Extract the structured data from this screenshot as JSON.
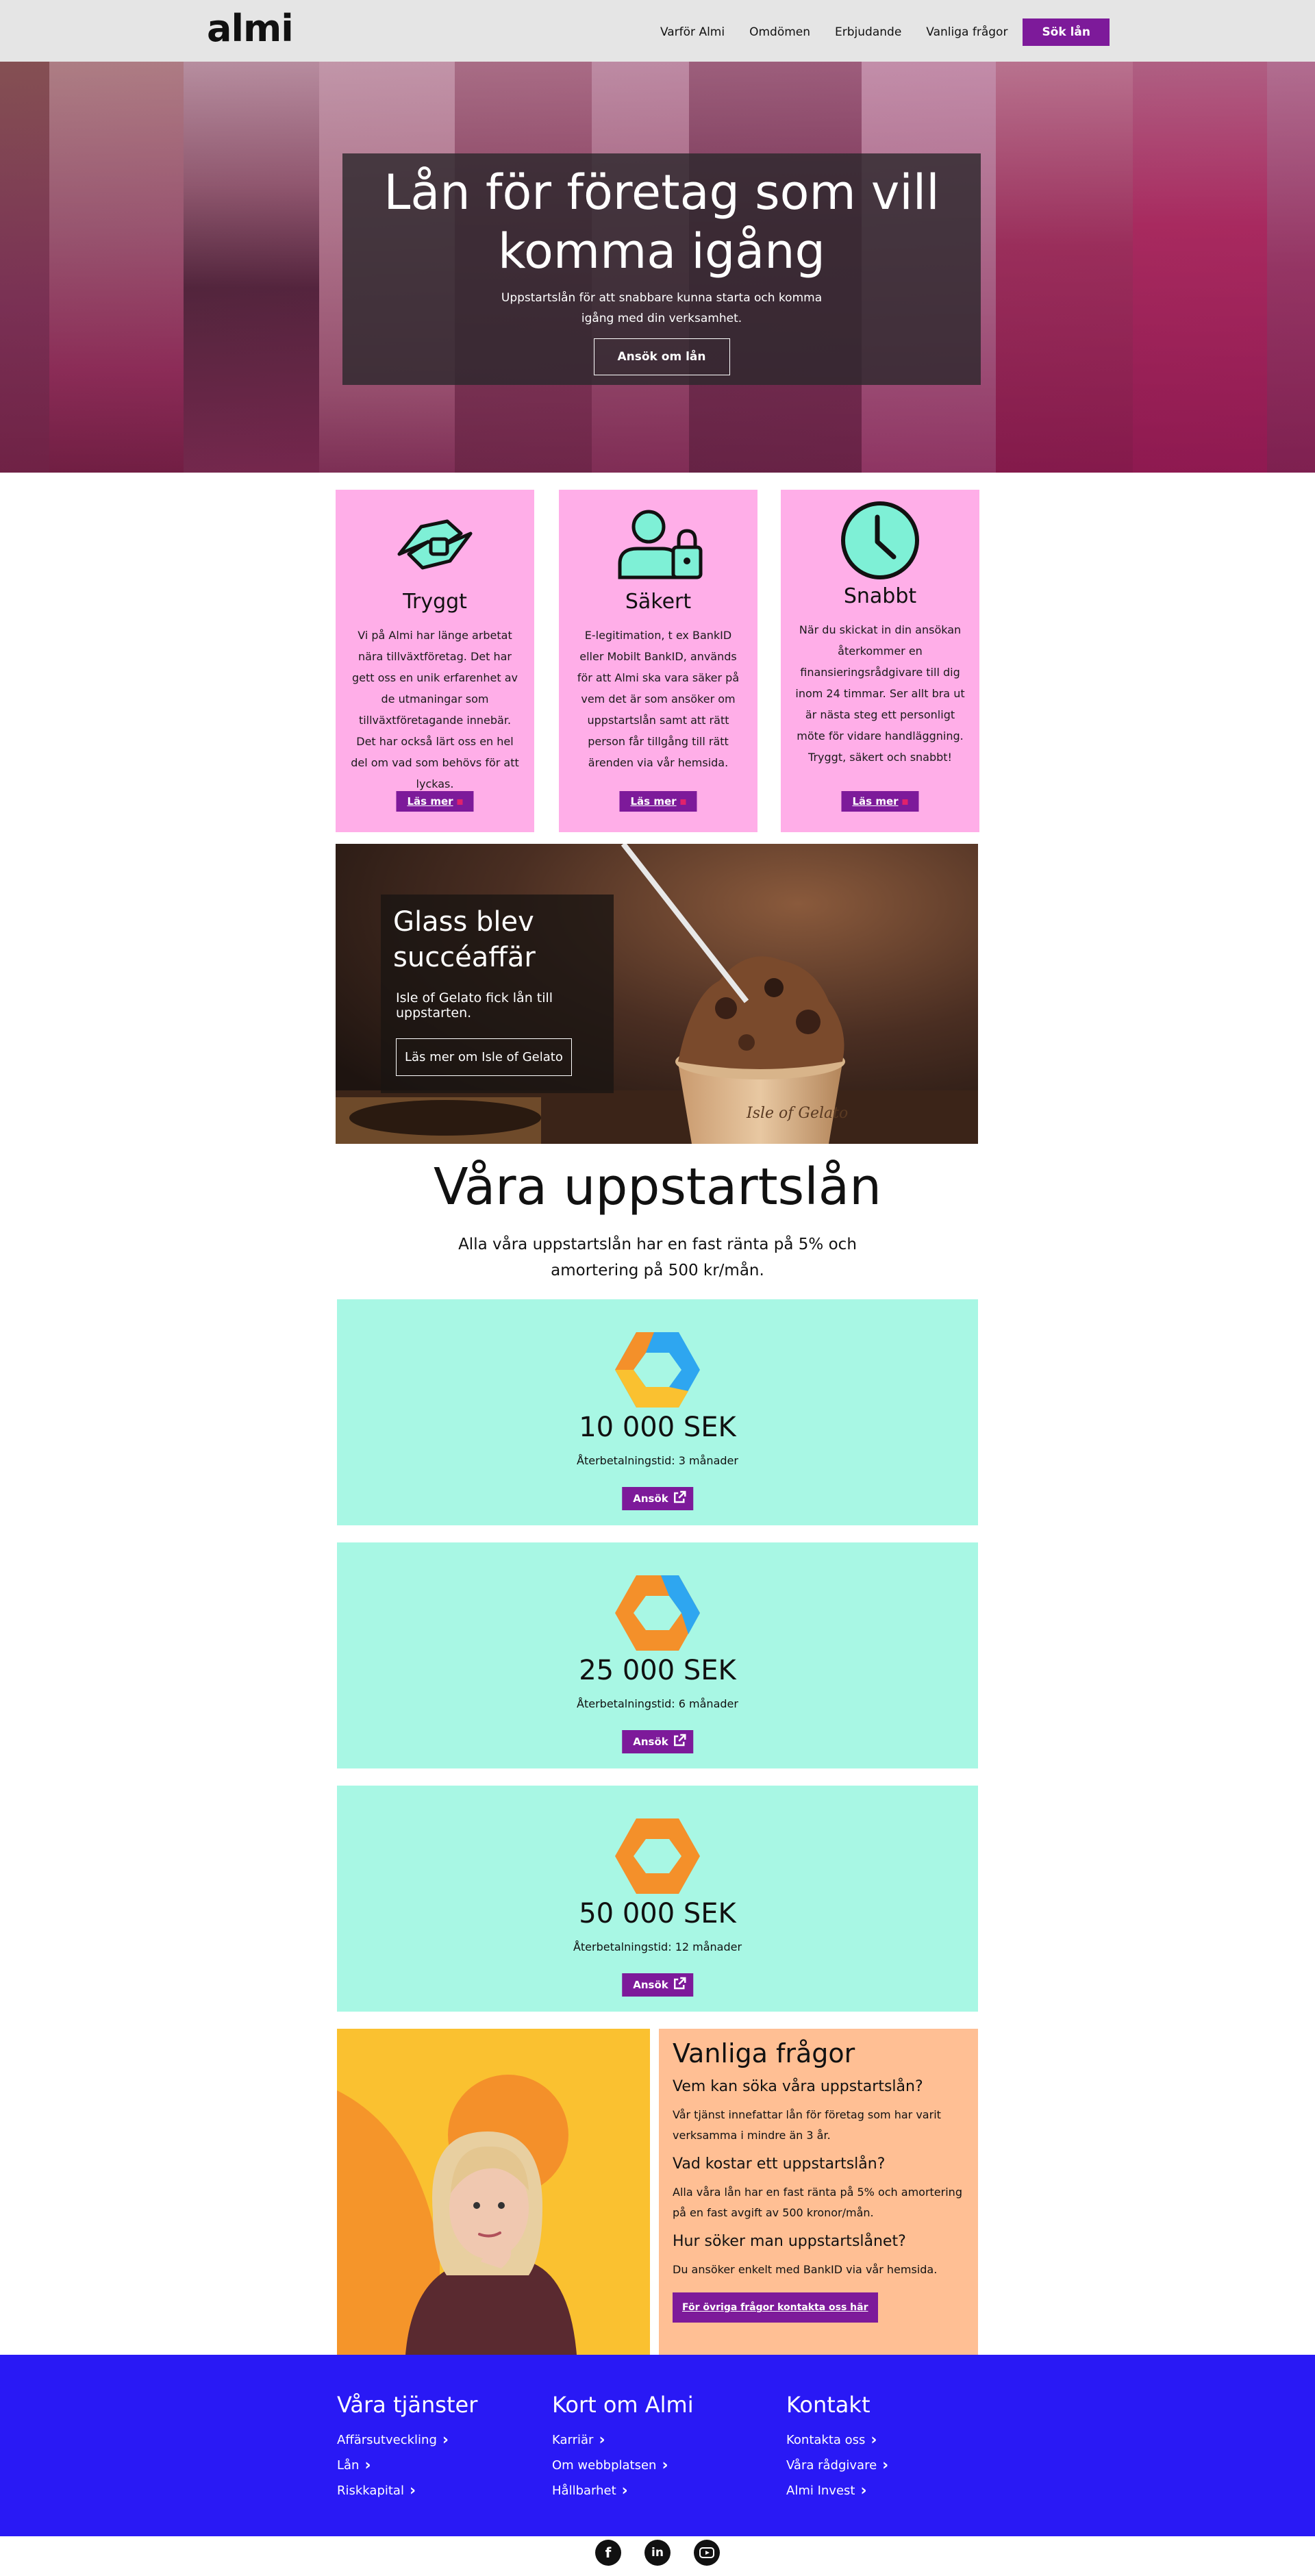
{
  "header": {
    "logo": "almi",
    "nav": [
      "Varför Almi",
      "Omdömen",
      "Erbjudande",
      "Vanliga frågor"
    ],
    "cta": "Sök lån"
  },
  "hero": {
    "title": "Lån för företag som vill komma igång",
    "subtitle": "Uppstartslån för att snabbare kunna starta och komma igång med din verksamhet.",
    "button": "Ansök om lån"
  },
  "features": [
    {
      "icon": "handshake-icon",
      "title": "Tryggt",
      "text": "Vi på Almi har länge arbetat nära tillväxtföretag. Det har gett oss en unik erfarenhet av de utmaningar som tillväxtföretagande innebär. Det har också lärt oss en hel del om vad som behövs för att lyckas.",
      "button": "Läs mer"
    },
    {
      "icon": "user-lock-icon",
      "title": "Säkert",
      "text": "E-legitimation, t ex BankID eller Mobilt BankID, används för att Almi ska vara säker på vem det är som ansöker om uppstartslån samt att rätt person får tillgång till rätt ärenden via vår hemsida.",
      "button": "Läs mer"
    },
    {
      "icon": "clock-icon",
      "title": "Snabbt",
      "text": "När du skickat in din ansökan återkommer en finansieringsrådgivare till dig inom 24 timmar. Ser allt bra ut är nästa steg ett personligt möte för vidare handläggning. Tryggt, säkert och snabbt!",
      "button": "Läs mer"
    }
  ],
  "banner": {
    "title": "Glass blev succéaffär",
    "text": "Isle of Gelato fick lån till uppstarten.",
    "button": "Läs mer om Isle of Gelato",
    "cup_text": "Isle of Gelato"
  },
  "loans_section": {
    "title": "Våra uppstartslån",
    "subtitle": "Alla våra uppstartslån har en fast ränta på 5% och amortering på 500 kr/mån."
  },
  "loans": [
    {
      "amount": "10 000 SEK",
      "term": "Återbetalningstid: 3 månader",
      "button": "Ansök"
    },
    {
      "amount": "25 000 SEK",
      "term": "Återbetalningstid: 6 månader",
      "button": "Ansök"
    },
    {
      "amount": "50 000 SEK",
      "term": "Återbetalningstid: 12 månader",
      "button": "Ansök"
    }
  ],
  "faq": {
    "title": "Vanliga frågor",
    "items": [
      {
        "q": "Vem kan söka våra uppstartslån?",
        "a": "Vår tjänst innefattar lån för företag som har varit verksamma i mindre än 3 år."
      },
      {
        "q": "Vad kostar ett uppstartslån?",
        "a": "Alla våra lån har en fast ränta på 5% och amortering på en fast avgift av 500 kronor/mån."
      },
      {
        "q": "Hur söker man uppstartslånet?",
        "a": "Du ansöker enkelt med BankID via vår hemsida."
      }
    ],
    "button": "För övriga frågor kontakta oss här"
  },
  "footer": {
    "columns": [
      {
        "title": "Våra tjänster",
        "links": [
          "Affärsutveckling",
          "Lån",
          "Riskkapital"
        ]
      },
      {
        "title": "Kort om Almi",
        "links": [
          "Karriär",
          "Om webbplatsen",
          "Hållbarhet"
        ]
      },
      {
        "title": "Kontakt",
        "links": [
          "Kontakta oss",
          "Våra rådgivare",
          "Almi Invest"
        ]
      }
    ]
  },
  "social": [
    "facebook-icon",
    "linkedin-icon",
    "youtube-icon"
  ],
  "colors": {
    "brand_purple": "#7d1a9a",
    "card_pink": "#ffaee8",
    "loan_mint": "#a8f7e4",
    "faq_peach": "#ffbf94",
    "footer_blue": "#2919f5"
  }
}
